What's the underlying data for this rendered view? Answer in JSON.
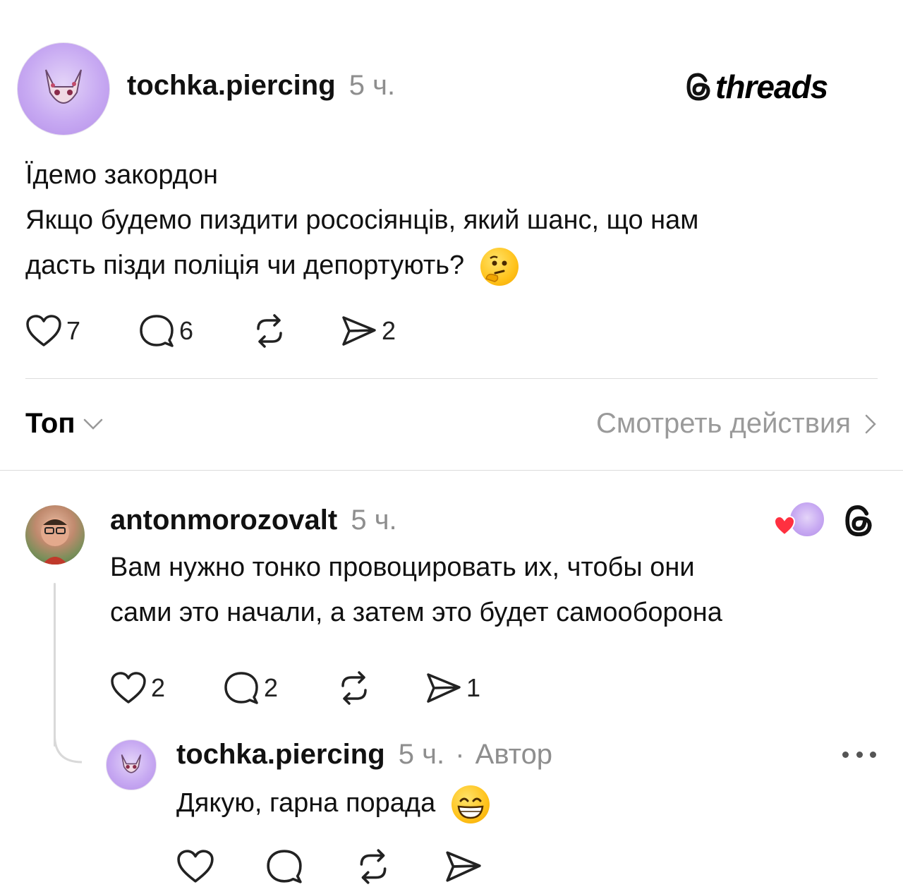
{
  "post": {
    "username": "tochka.piercing",
    "time": "5 ч.",
    "brand": "threads",
    "text_line1": "Їдемо закордон",
    "text_line2": "Якщо будемо пиздити рососіянців, який шанс, що нам",
    "text_line3": "дасть пізди поліція чи депортують?",
    "emoji": "thinking-face",
    "likes": "7",
    "comments": "6",
    "shares": "2"
  },
  "sort": {
    "label": "Топ",
    "activity_link": "Смотреть действия"
  },
  "reply1": {
    "username": "antonmorozovalt",
    "time": "5 ч.",
    "text_line1": "Вам нужно тонко провоцировать их, чтобы они",
    "text_line2": "сами это начали, а затем это будет самооборона",
    "likes": "2",
    "comments": "2",
    "shares": "1"
  },
  "reply2": {
    "username": "tochka.piercing",
    "time": "5 ч.",
    "separator": "·",
    "author_label": "Автор",
    "text": "Дякую, гарна порада",
    "emoji": "grinning-face"
  },
  "colors": {
    "text": "#111111",
    "muted": "#8e8e8e",
    "divider": "#dcdcdc",
    "heart_red": "#ff3040",
    "avatar_purple": "#c7a9f2"
  }
}
